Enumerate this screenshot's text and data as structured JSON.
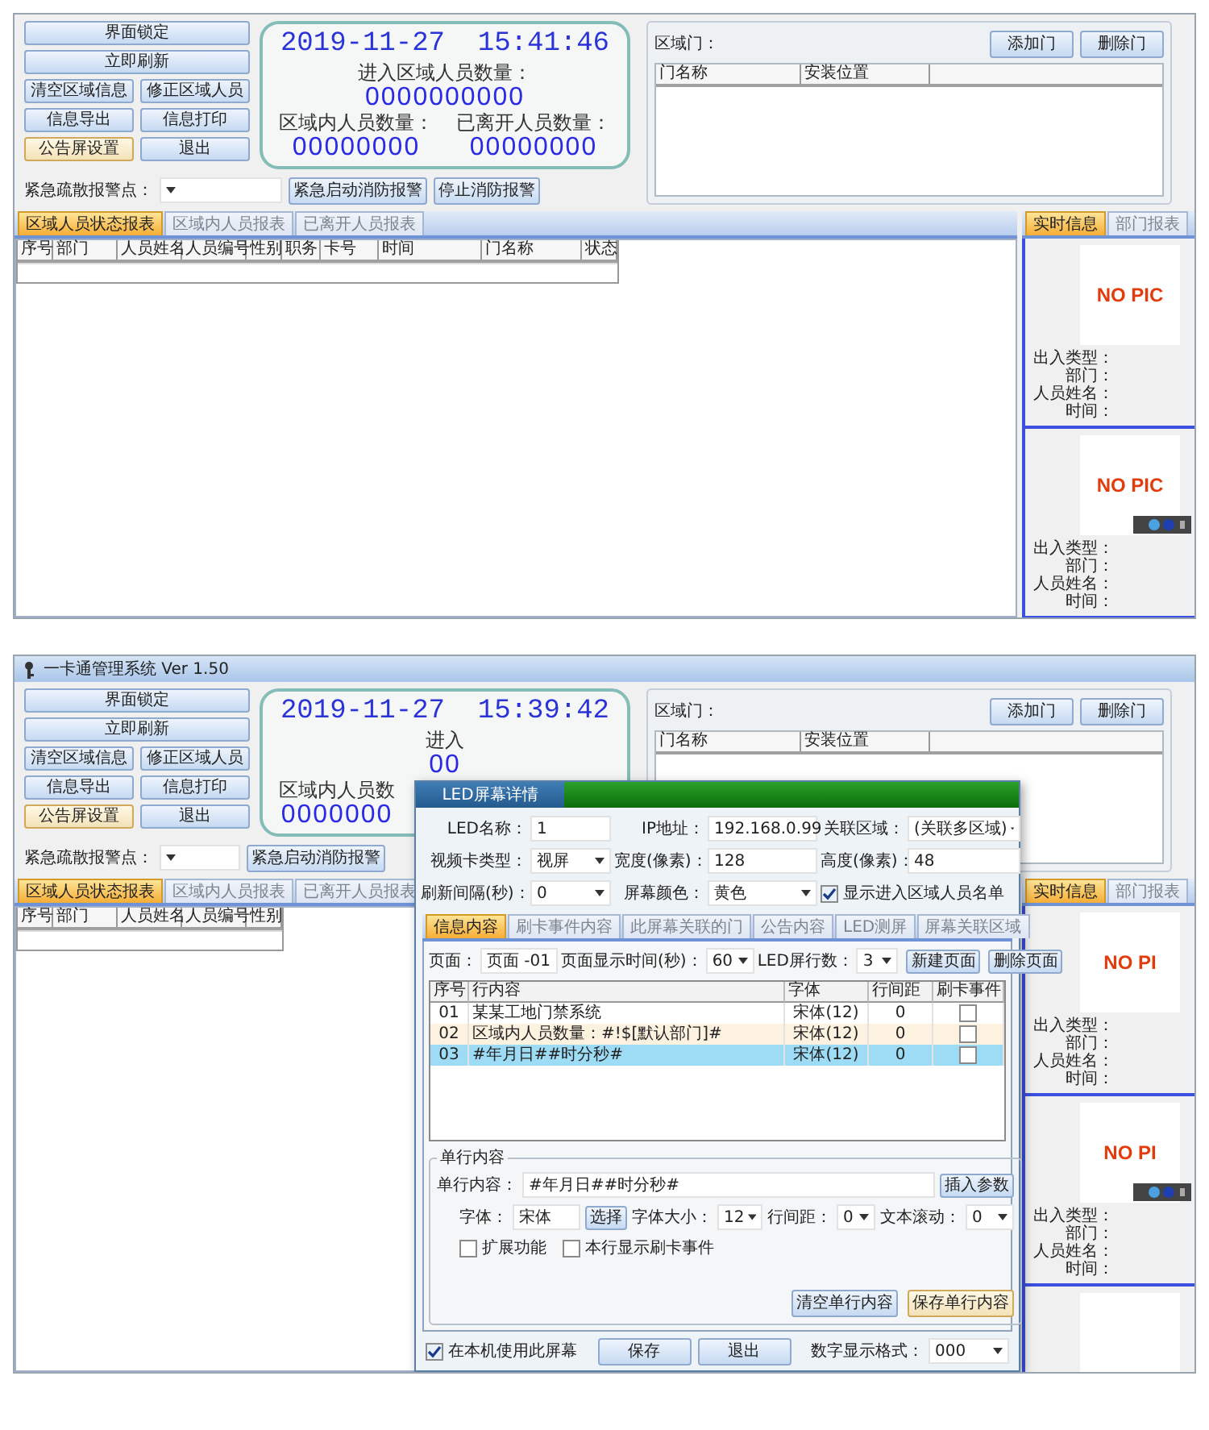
{
  "screens": [
    {
      "kind": "main",
      "button_rows": [
        [
          {
            "label": "界面锁定",
            "focused": false
          }
        ],
        [
          {
            "label": "立即刷新",
            "focused": false
          }
        ],
        [
          {
            "label": "清空区域信息",
            "focused": false
          },
          {
            "label": "修正区域人员",
            "focused": false
          }
        ],
        [
          {
            "label": "信息导出",
            "focused": false
          },
          {
            "label": "信息打印",
            "focused": false
          }
        ],
        [
          {
            "label": "公告屏设置",
            "focused": true
          },
          {
            "label": "退出",
            "focused": false
          }
        ]
      ],
      "clock": {
        "time": "2019-11-27  15:41:46",
        "entered_label": "进入区域人员数量：",
        "entered_count": "0000000000",
        "inside_label": "区域内人员数量：",
        "inside_count": "00000000",
        "left_label": "已离开人员数量：",
        "left_count": "00000000"
      },
      "alarm": {
        "label": "紧急疏散报警点：",
        "buttons": [
          "紧急启动消防报警",
          "停止消防报警"
        ]
      },
      "doors": {
        "label": "区域门：",
        "buttons": [
          "添加门",
          "删除门"
        ],
        "columns": [
          "门名称",
          "安装位置"
        ]
      },
      "tabs": [
        {
          "label": "区域人员状态报表",
          "selected": true
        },
        {
          "label": "区域内人员报表",
          "selected": false
        },
        {
          "label": "已离开人员报表",
          "selected": false
        }
      ],
      "table": {
        "columns": [
          "序号",
          "部门",
          "人员姓名",
          "人员编号",
          "性别",
          "职务",
          "卡号",
          "时间",
          "门名称",
          "状态"
        ]
      },
      "side": {
        "tabs": [
          {
            "label": "实时信息",
            "selected": true
          },
          {
            "label": "部门报表",
            "selected": false
          }
        ],
        "cards": [
          {
            "kind": "photo",
            "photo_text": "NO PIC",
            "toolbar": false,
            "fields": [
              "出入类型：",
              "部门：",
              "人员姓名：",
              "时间："
            ]
          },
          {
            "kind": "photo",
            "photo_text": "NO PIC",
            "toolbar": true,
            "fields": [
              "出入类型：",
              "部门：",
              "人员姓名：",
              "时间："
            ]
          }
        ]
      }
    },
    {
      "kind": "covered",
      "title": "一卡通管理系统 Ver 1.50",
      "button_rows": [
        [
          {
            "label": "界面锁定",
            "focused": false
          }
        ],
        [
          {
            "label": "立即刷新",
            "focused": false
          }
        ],
        [
          {
            "label": "清空区域信息",
            "focused": false
          },
          {
            "label": "修正区域人员",
            "focused": false
          }
        ],
        [
          {
            "label": "信息导出",
            "focused": false
          },
          {
            "label": "信息打印",
            "focused": false
          }
        ],
        [
          {
            "label": "公告屏设置",
            "focused": true
          },
          {
            "label": "退出",
            "focused": false
          }
        ]
      ],
      "clock": {
        "time": "2019-11-27  15:39:42",
        "entered_label": "进入",
        "entered_count": "00",
        "inside_label": "区域内人员数",
        "inside_count": "0000000"
      },
      "alarm": {
        "label": "紧急疏散报警点：",
        "buttons": [
          "紧急启动消防报警"
        ]
      },
      "doors": {
        "label": "区域门：",
        "buttons": [
          "添加门",
          "删除门"
        ],
        "columns": [
          "门名称",
          "安装位置"
        ]
      },
      "tabs": [
        {
          "label": "区域人员状态报表",
          "selected": true
        },
        {
          "label": "区域内人员报表",
          "selected": false
        },
        {
          "label": "已离开人员报表",
          "selected": false
        }
      ],
      "table": {
        "columns": [
          "序号",
          "部门",
          "人员姓名",
          "人员编号",
          "性别"
        ]
      },
      "side": {
        "tabs": [
          {
            "label": "实时信息",
            "selected": true
          },
          {
            "label": "部门报表",
            "selected": false
          }
        ],
        "cards": [
          {
            "kind": "photo",
            "photo_text": "NO PI",
            "toolbar": false,
            "fields": [
              "出入类型：",
              "部门：",
              "人员姓名：",
              "时间："
            ]
          },
          {
            "kind": "photo",
            "photo_text": "NO PI",
            "toolbar": true,
            "fields": [
              "出入类型：",
              "部门：",
              "人员姓名：",
              "时间："
            ]
          },
          {
            "kind": "cut"
          }
        ]
      },
      "dialog": {
        "title": "LED屏幕详情",
        "fields": [
          {
            "kind": "text",
            "label": "LED名称：",
            "value": "1"
          },
          {
            "kind": "text",
            "label": "IP地址：",
            "value": "192.168.0.99"
          },
          {
            "kind": "select",
            "label": "关联区域：",
            "value": "(关联多区域)"
          },
          {
            "kind": "select",
            "label": "视频卡类型：",
            "value": "视屏"
          },
          {
            "kind": "text",
            "label": "宽度(像素)：",
            "value": "128"
          },
          {
            "kind": "text",
            "label": "高度(像素)：",
            "value": "48"
          },
          {
            "kind": "select",
            "label": "刷新间隔(秒)：",
            "value": "0"
          },
          {
            "kind": "select",
            "label": "屏幕颜色：",
            "value": "黄色"
          },
          {
            "kind": "checkbox",
            "label": "显示进入区域人员名单",
            "checked": true
          }
        ],
        "tabs": [
          {
            "label": "信息内容",
            "selected": true
          },
          {
            "label": "刷卡事件内容",
            "selected": false
          },
          {
            "label": "此屏幕关联的门",
            "selected": false
          },
          {
            "label": "公告内容",
            "selected": false
          },
          {
            "label": "LED测屏",
            "selected": false
          },
          {
            "label": "屏幕关联区域",
            "selected": false
          }
        ],
        "page_row": {
          "fields": [
            {
              "label": "页面：",
              "value": "页面 -01"
            },
            {
              "label": "页面显示时间(秒)：",
              "value": "60"
            },
            {
              "label": "LED屏行数：",
              "value": "3"
            }
          ],
          "buttons": [
            "新建页面",
            "删除页面"
          ]
        },
        "lines": {
          "columns": [
            "序号",
            "行内容",
            "字体",
            "行间距",
            "刷卡事件"
          ],
          "rows": [
            {
              "no": "01",
              "content": "某某工地门禁系统",
              "font": "宋体(12)",
              "spacing": "0",
              "checked": false,
              "selected": false
            },
            {
              "no": "02",
              "content": "区域内人员数量：#!$[默认部门]#",
              "font": "宋体(12)",
              "spacing": "0",
              "checked": false,
              "selected": false
            },
            {
              "no": "03",
              "content": "#年月日##时分秒#",
              "font": "宋体(12)",
              "spacing": "0",
              "checked": false,
              "selected": true
            }
          ]
        },
        "single_line": {
          "legend": "单行内容",
          "content_label": "单行内容：",
          "content": "#年月日##时分秒#",
          "insert_button": "插入参数",
          "font_label": "字体：",
          "font": "宋体",
          "choose_button": "选择",
          "size_label": "字体大小：",
          "size": "12",
          "spacing_label": "行间距：",
          "spacing": "0",
          "scroll_label": "文本滚动：",
          "scroll": "0",
          "options": [
            {
              "label": "扩展功能",
              "checked": false
            },
            {
              "label": "本行显示刷卡事件",
              "checked": false
            }
          ],
          "buttons": [
            {
              "label": "清空单行内容",
              "focused": false
            },
            {
              "label": "保存单行内容",
              "focused": true
            }
          ]
        },
        "footer": {
          "use_here": {
            "label": "在本机使用此屏幕",
            "checked": true
          },
          "buttons": [
            "保存",
            "退出"
          ],
          "format_label": "数字显示格式：",
          "format": "000"
        }
      }
    }
  ]
}
